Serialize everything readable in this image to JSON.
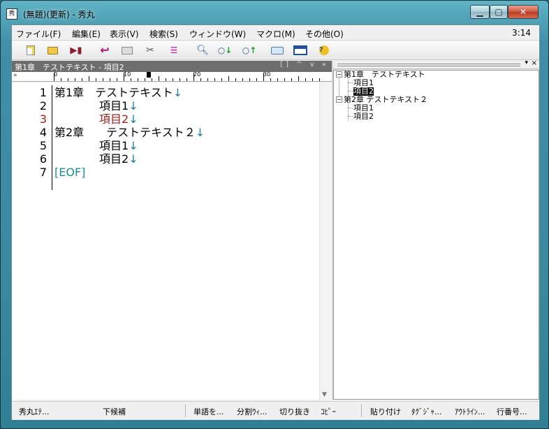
{
  "window": {
    "title": "(無題)(更新) - 秀丸",
    "app_icon_glyph": "秀"
  },
  "menu": {
    "items": [
      "ファイル(F)",
      "編集(E)",
      "表示(V)",
      "検索(S)",
      "ウィンドウ(W)",
      "マクロ(M)",
      "その他(O)"
    ],
    "clock": "3:14"
  },
  "toolbar": {
    "icons": [
      "new-file-icon",
      "open-folder-icon",
      "save-icon",
      "undo-icon",
      "copy-window-icon",
      "cut-icon",
      "paste-icon",
      "search-icon",
      "search-down-icon",
      "search-up-icon",
      "tag-jump-icon",
      "split-window-icon",
      "help-icon"
    ]
  },
  "editor": {
    "header_title": "第1章　テストテキスト - 項目2",
    "header_controls": "[] ^ v »",
    "ruler_marks": [
      "0",
      "10",
      "20",
      "30"
    ],
    "gutter_mark": "»",
    "lines": [
      {
        "num": "1",
        "text": "第1章　テストテキスト",
        "nl": "↓"
      },
      {
        "num": "2",
        "text": "　　　　項目1",
        "nl": "↓"
      },
      {
        "num": "3",
        "text": "　　　　項目2",
        "nl": "↓",
        "current": true
      },
      {
        "num": "4",
        "text": "第2章　　テストテキスト２",
        "nl": "↓"
      },
      {
        "num": "5",
        "text": "　　　　項目1",
        "nl": "↓"
      },
      {
        "num": "6",
        "text": "　　　　項目2",
        "nl": "↓"
      },
      {
        "num": "7",
        "text": "[EOF]",
        "nl": "",
        "eof": true
      }
    ],
    "current_line_color": "#a0201c",
    "newline_color": "#1a7ea0"
  },
  "outline": {
    "pin": "▾",
    "close": "×",
    "nodes": [
      {
        "label": "第1章　テストテキスト",
        "expander": "−"
      },
      {
        "label": "項目1"
      },
      {
        "label": "項目2",
        "selected": true
      },
      {
        "label": "第2章 テストテキスト２",
        "expander": "−"
      },
      {
        "label": "項目1"
      },
      {
        "label": "項目2"
      }
    ]
  },
  "status": {
    "items": [
      "秀丸ｴﾃ...",
      "下候補",
      "単語を...",
      "分割ｳｨ...",
      "切り抜き",
      "ｺﾋﾟｰ",
      "貼り付け",
      "ﾀｸﾞｼﾞｬ...",
      "ｱｳﾄﾗｲﾝ...",
      "行番号..."
    ]
  }
}
